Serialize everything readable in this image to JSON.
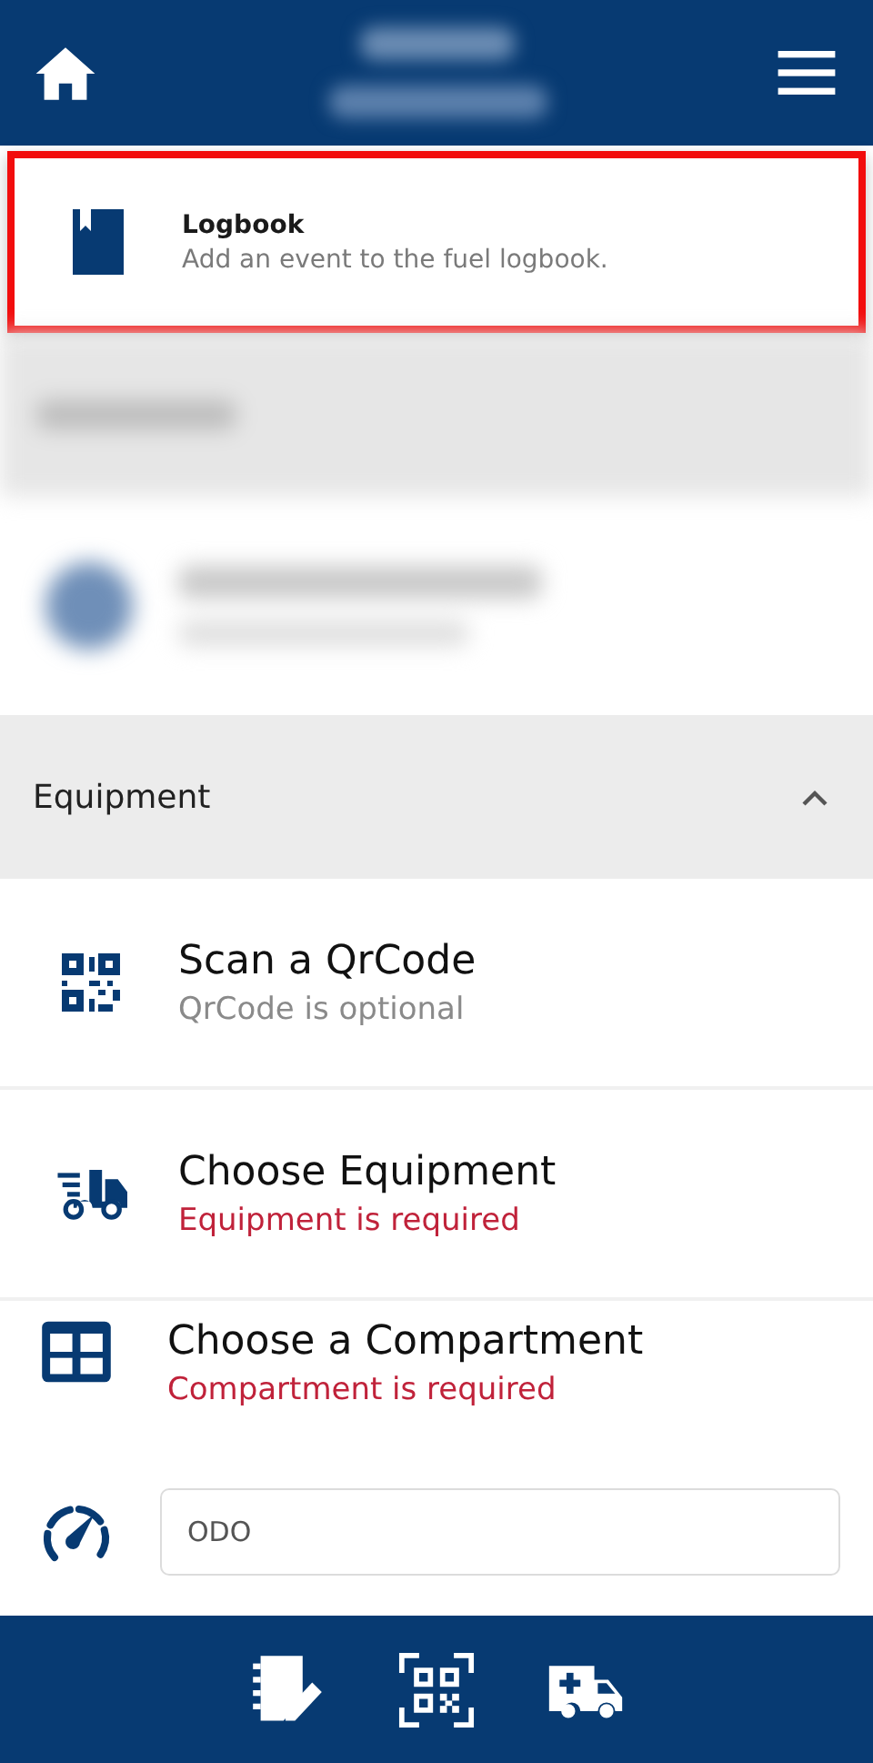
{
  "logbook_card": {
    "title": "Logbook",
    "subtitle": "Add an event to the fuel logbook.",
    "highlighted": true
  },
  "section": {
    "title": "Equipment",
    "expanded": true
  },
  "items": [
    {
      "kind": "qr",
      "title": "Scan a QrCode",
      "hint": "QrCode is optional",
      "required": false
    },
    {
      "kind": "truck",
      "title": "Choose Equipment",
      "hint": "Equipment is required",
      "required": true
    },
    {
      "kind": "grid",
      "title": "Choose a Compartment",
      "hint": "Compartment is required",
      "required": true
    }
  ],
  "odo_field": {
    "placeholder": "ODO"
  }
}
